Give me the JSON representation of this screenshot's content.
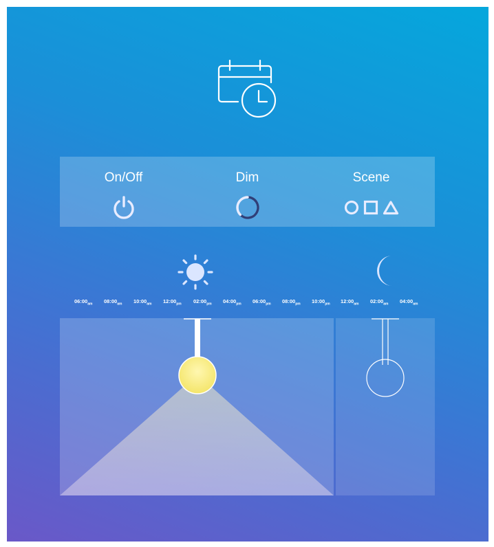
{
  "header": {
    "icon": "calendar-clock-icon"
  },
  "modes": [
    {
      "label": "On/Off",
      "icon": "power-icon"
    },
    {
      "label": "Dim",
      "icon": "dim-icon"
    },
    {
      "label": "Scene",
      "icon": "scene-shapes-icon"
    }
  ],
  "timeline": {
    "day_icon": "sun-icon",
    "night_icon": "moon-icon",
    "ticks": [
      {
        "time": "06:00",
        "period": "am"
      },
      {
        "time": "08:00",
        "period": "am"
      },
      {
        "time": "10:00",
        "period": "am"
      },
      {
        "time": "12:00",
        "period": "pm"
      },
      {
        "time": "02:00",
        "period": "pm"
      },
      {
        "time": "04:00",
        "period": "pm"
      },
      {
        "time": "06:00",
        "period": "pm"
      },
      {
        "time": "08:00",
        "period": "pm"
      },
      {
        "time": "10:00",
        "period": "pm"
      },
      {
        "time": "12:00",
        "period": "am"
      },
      {
        "time": "02:00",
        "period": "am"
      },
      {
        "time": "04:00",
        "period": "am"
      }
    ]
  },
  "lamps": {
    "day": {
      "state": "on",
      "color": "#f8ee8a"
    },
    "night": {
      "state": "off"
    }
  }
}
